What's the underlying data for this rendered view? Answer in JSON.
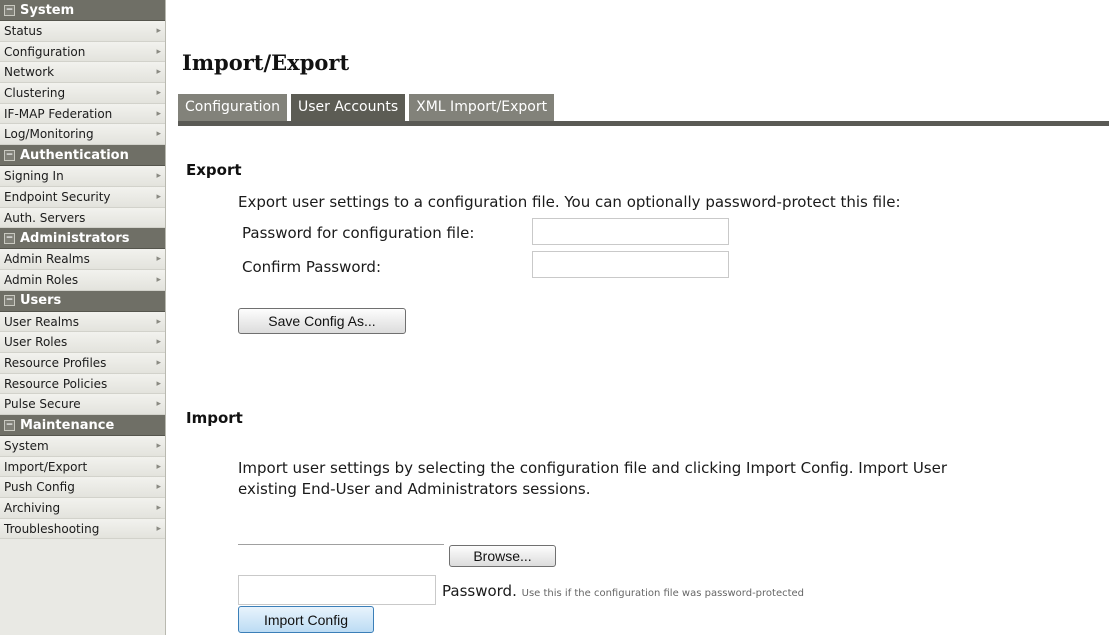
{
  "sidebar": {
    "sections": [
      {
        "title": "System",
        "items": [
          {
            "label": "Status",
            "arrow": true
          },
          {
            "label": "Configuration",
            "arrow": true
          },
          {
            "label": "Network",
            "arrow": true
          },
          {
            "label": "Clustering",
            "arrow": true
          },
          {
            "label": "IF-MAP Federation",
            "arrow": true
          },
          {
            "label": "Log/Monitoring",
            "arrow": true
          }
        ]
      },
      {
        "title": "Authentication",
        "items": [
          {
            "label": "Signing In",
            "arrow": true
          },
          {
            "label": "Endpoint Security",
            "arrow": true
          },
          {
            "label": "Auth. Servers",
            "arrow": false
          }
        ]
      },
      {
        "title": "Administrators",
        "items": [
          {
            "label": "Admin Realms",
            "arrow": true
          },
          {
            "label": "Admin Roles",
            "arrow": true
          }
        ]
      },
      {
        "title": "Users",
        "items": [
          {
            "label": "User Realms",
            "arrow": true
          },
          {
            "label": "User Roles",
            "arrow": true
          },
          {
            "label": "Resource Profiles",
            "arrow": true
          },
          {
            "label": "Resource Policies",
            "arrow": true
          },
          {
            "label": "Pulse Secure",
            "arrow": true
          }
        ]
      },
      {
        "title": "Maintenance",
        "items": [
          {
            "label": "System",
            "arrow": true
          },
          {
            "label": "Import/Export",
            "arrow": true
          },
          {
            "label": "Push Config",
            "arrow": true
          },
          {
            "label": "Archiving",
            "arrow": true
          },
          {
            "label": "Troubleshooting",
            "arrow": true
          }
        ]
      }
    ],
    "collapse_glyph": "−",
    "arrow_glyph": "▸"
  },
  "page": {
    "title": "Import/Export"
  },
  "tabs": [
    {
      "label": "Configuration",
      "active": false
    },
    {
      "label": "User Accounts",
      "active": true
    },
    {
      "label": "XML Import/Export",
      "active": false
    }
  ],
  "export": {
    "heading": "Export",
    "description": "Export user settings to a configuration file. You can optionally password-protect this file:",
    "password_label": "Password for configuration file:",
    "confirm_label": "Confirm Password:",
    "password_value": "",
    "confirm_value": "",
    "save_button": "Save Config As..."
  },
  "import": {
    "heading": "Import",
    "description_line1": "Import user settings by selecting the configuration file and clicking Import Config. Import User",
    "description_line2": "existing End-User and Administrators sessions.",
    "browse_button": "Browse...",
    "password_label": "Password.",
    "password_hint": "Use this if the configuration file was password-protected",
    "password_value": "",
    "import_button": "Import Config"
  }
}
